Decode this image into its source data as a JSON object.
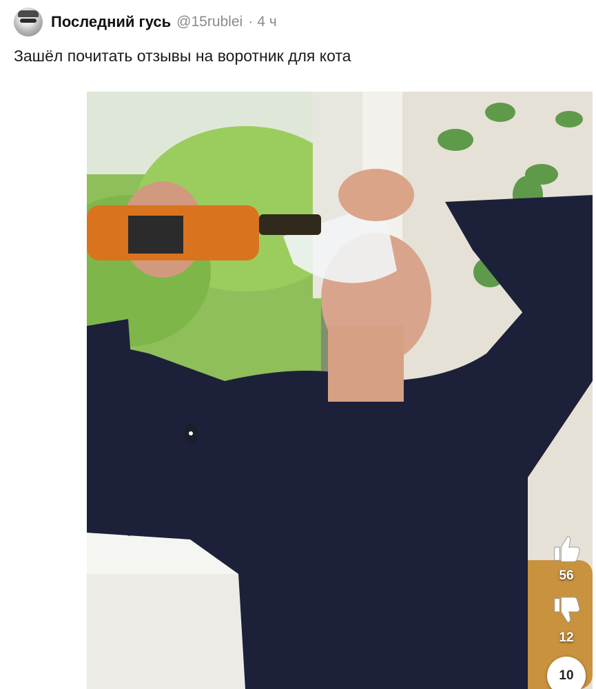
{
  "post": {
    "author_name": "Последний гусь",
    "author_handle": "@15rublei",
    "separator": "·",
    "time_ago": "4 ч",
    "text": "Зашёл почитать отзывы на воротник для кота"
  },
  "media": {
    "icons": {
      "avatar": "goose-avatar",
      "like": "thumbs-up-icon",
      "dislike": "thumbs-down-icon"
    },
    "likes": "56",
    "dislikes": "12",
    "comments": "10"
  },
  "colors": {
    "text_primary": "#111111",
    "text_secondary": "#8a8a8a"
  }
}
